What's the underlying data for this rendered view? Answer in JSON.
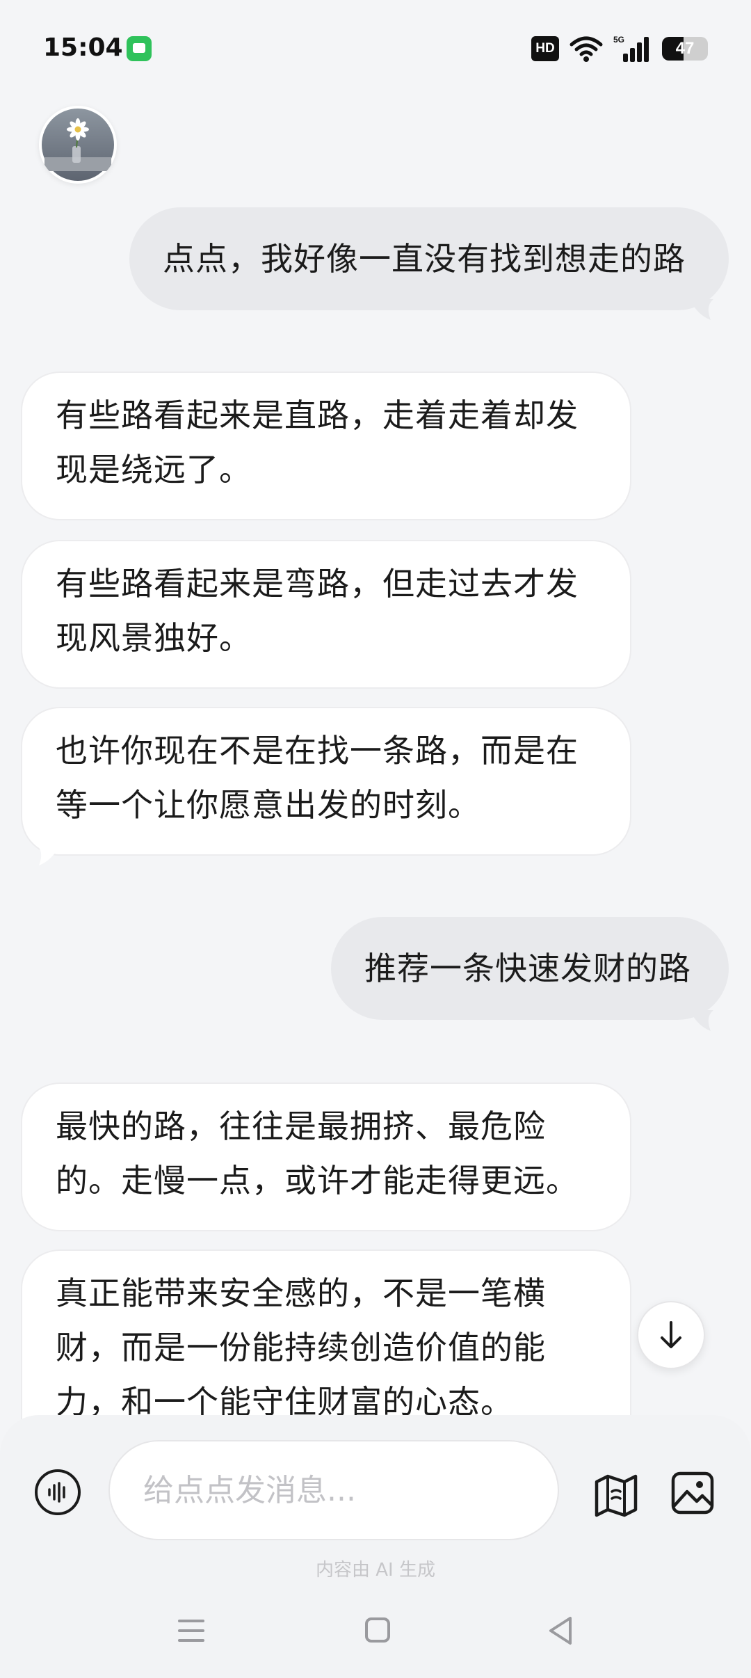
{
  "status_bar": {
    "time": "15:04",
    "hd_label": "HD",
    "network_label": "5G",
    "battery_level": 47,
    "battery_text": "47"
  },
  "chat": {
    "messages": [
      {
        "role": "user",
        "text": "点点，我好像一直没有找到想走的路"
      },
      {
        "role": "assistant",
        "text": "有些路看起来是直路，走着走着却发现是绕远了。"
      },
      {
        "role": "assistant",
        "text": "有些路看起来是弯路，但走过去才发现风景独好。"
      },
      {
        "role": "assistant",
        "text": "也许你现在不是在找一条路，而是在等一个让你愿意出发的时刻。"
      },
      {
        "role": "user",
        "text": "推荐一条快速发财的路"
      },
      {
        "role": "assistant",
        "text": "最快的路，往往是最拥挤、最危险的。走慢一点，或许才能走得更远。"
      },
      {
        "role": "assistant",
        "text": "真正能带来安全感的，不是一笔横财，而是一份能持续创造价值的能力，和一个能守住财富的心态。"
      }
    ]
  },
  "composer": {
    "placeholder": "给点点发消息...",
    "value": "",
    "disclaimer": "内容由 AI 生成"
  },
  "icons": {
    "voice": "voice-waveform-icon",
    "map": "map-icon",
    "image": "image-icon",
    "scroll_down": "arrow-down-icon"
  },
  "colors": {
    "background": "#f4f5f7",
    "user_bubble": "#e8e9ec",
    "assistant_bubble": "#ffffff",
    "status_green": "#2fc25b"
  }
}
